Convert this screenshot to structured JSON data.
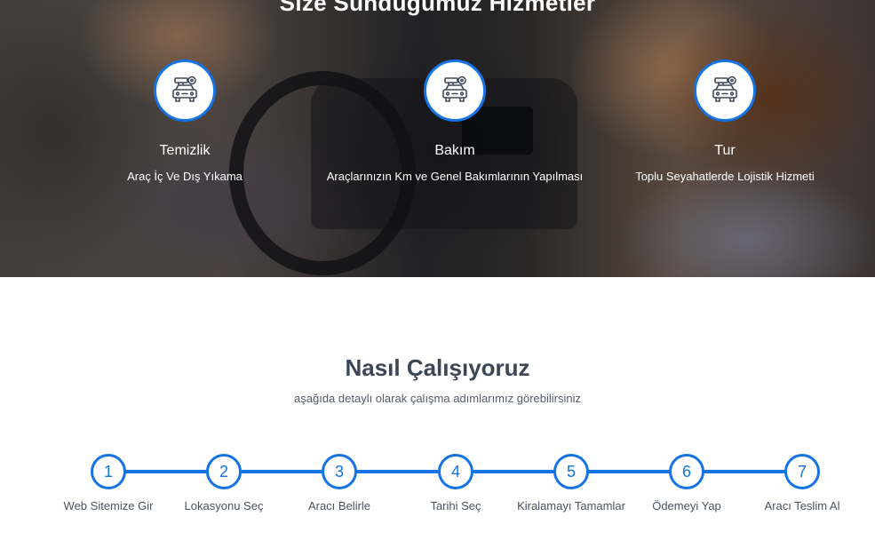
{
  "hero": {
    "title": "Size Sunduğumuz Hizmetler",
    "services": [
      {
        "title": "Temizlik",
        "description": "Araç İç Ve Dış Yıkama",
        "icon": "car-key-icon"
      },
      {
        "title": "Bakım",
        "description": "Araçlarınızın Km ve Genel Bakımlarının Yapılması",
        "icon": "car-key-icon"
      },
      {
        "title": "Tur",
        "description": "Toplu Seyahatlerde Lojistik Hizmeti",
        "icon": "car-key-icon"
      }
    ]
  },
  "how": {
    "title": "Nasıl Çalışıyoruz",
    "subtitle": "aşağıda detaylı olarak çalışma adımlarımız görebilirsiniz",
    "steps": [
      {
        "number": "1",
        "label": "Web Sitemize Gir"
      },
      {
        "number": "2",
        "label": "Lokasyonu Seç"
      },
      {
        "number": "3",
        "label": "Aracı Belirle"
      },
      {
        "number": "4",
        "label": "Tarihi Seç"
      },
      {
        "number": "5",
        "label": "Kiralamayı Tamamlar"
      },
      {
        "number": "6",
        "label": "Ödemeyi Yap"
      },
      {
        "number": "7",
        "label": "Aracı Teslim Al"
      }
    ]
  },
  "colors": {
    "accent": "#1573e6",
    "heading": "#3b4656"
  }
}
